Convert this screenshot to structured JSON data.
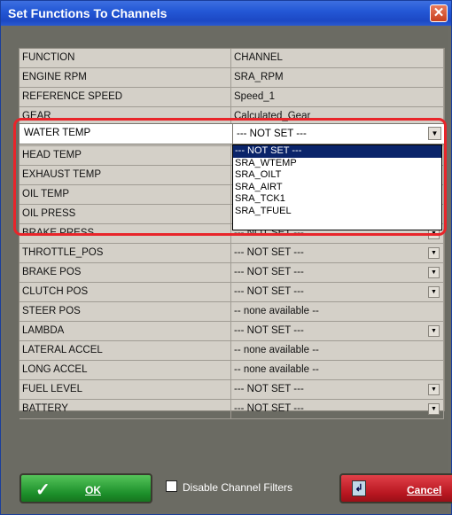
{
  "window": {
    "title": "Set Functions To Channels",
    "close_glyph": "✕"
  },
  "grid": {
    "headers": [
      "FUNCTION",
      "CHANNEL"
    ],
    "rows": [
      {
        "function": "ENGINE RPM",
        "channel": "SRA_RPM",
        "dropdown": false
      },
      {
        "function": "REFERENCE SPEED",
        "channel": "Speed_1",
        "dropdown": false
      },
      {
        "function": "GEAR",
        "channel": "Calculated_Gear",
        "dropdown": false
      },
      {
        "function": "WATER TEMP",
        "channel": "--- NOT SET ---",
        "dropdown": true
      },
      {
        "function": "HEAD TEMP",
        "channel": "",
        "dropdown": false
      },
      {
        "function": "EXHAUST TEMP",
        "channel": "",
        "dropdown": false
      },
      {
        "function": "OIL TEMP",
        "channel": "",
        "dropdown": false
      },
      {
        "function": "OIL PRESS",
        "channel": "",
        "dropdown": false
      },
      {
        "function": "BRAKE PRESS",
        "channel": "--- NOT SET ---",
        "dropdown": true
      },
      {
        "function": "THROTTLE_POS",
        "channel": "--- NOT SET ---",
        "dropdown": true
      },
      {
        "function": "BRAKE POS",
        "channel": "--- NOT SET ---",
        "dropdown": true
      },
      {
        "function": "CLUTCH POS",
        "channel": "--- NOT SET ---",
        "dropdown": true
      },
      {
        "function": "STEER POS",
        "channel": "-- none available --",
        "dropdown": false
      },
      {
        "function": "LAMBDA",
        "channel": "--- NOT SET ---",
        "dropdown": true
      },
      {
        "function": "LATERAL ACCEL",
        "channel": "-- none available --",
        "dropdown": false
      },
      {
        "function": "LONG ACCEL",
        "channel": "-- none available --",
        "dropdown": false
      },
      {
        "function": "FUEL LEVEL",
        "channel": "--- NOT SET ---",
        "dropdown": true
      },
      {
        "function": "BATTERY",
        "channel": "--- NOT SET ---",
        "dropdown": true
      }
    ]
  },
  "editing": {
    "function": "WATER TEMP",
    "selected_value": "--- NOT SET ---",
    "options": [
      "--- NOT SET ---",
      "SRA_WTEMP",
      "SRA_OILT",
      "SRA_AIRT",
      "SRA_TCK1",
      "SRA_TFUEL"
    ],
    "selected_index": 0,
    "highlight_color": "#e8252a"
  },
  "footer": {
    "ok_label": "OK",
    "filter_label": "Disable Channel Filters",
    "filter_checked": false,
    "cancel_label": "Cancel"
  },
  "colors": {
    "title_bar": "#2458d6",
    "selection": "#0a246a",
    "ok_button": "#1c8f2a",
    "cancel_button": "#b81620"
  }
}
